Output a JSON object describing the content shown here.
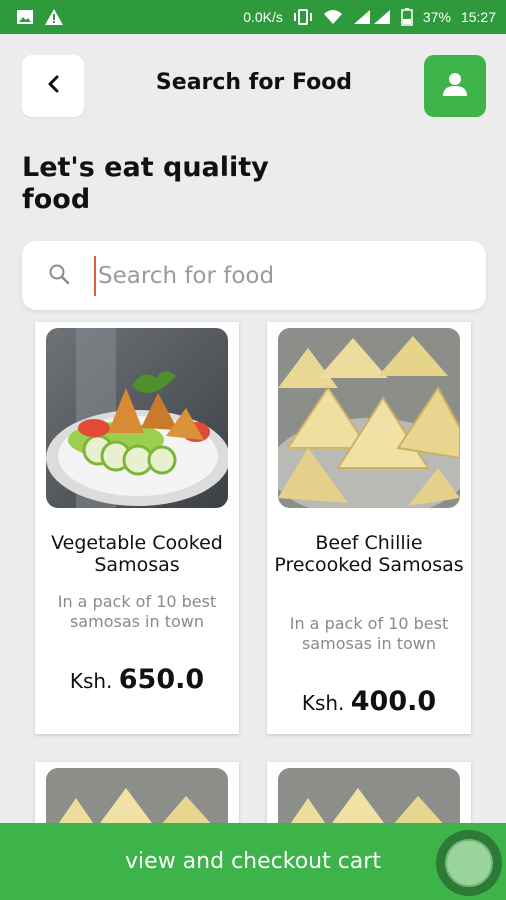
{
  "status_bar": {
    "net_speed": "0.0K/s",
    "battery": "37%",
    "time": "15:27",
    "bg_color": "#2f9a3c"
  },
  "header": {
    "back_icon": "chevron-left-icon",
    "title": "Search for Food",
    "profile_icon": "user-icon",
    "accent_color": "#3db44a"
  },
  "headline": "Let's eat quality food",
  "search": {
    "placeholder": "Search for food",
    "value": "",
    "icon": "search-icon"
  },
  "products": [
    {
      "name": "Vegetable Cooked Samosas",
      "description": "In a pack of 10 best samosas in town",
      "currency": "Ksh.",
      "price": "650.0"
    },
    {
      "name": "Beef Chillie Precooked Samosas",
      "description": "In a pack of 10 best samosas in town",
      "currency": "Ksh.",
      "price": "400.0"
    }
  ],
  "cart": {
    "label": "view and checkout cart",
    "bg_color": "#3db44a"
  }
}
